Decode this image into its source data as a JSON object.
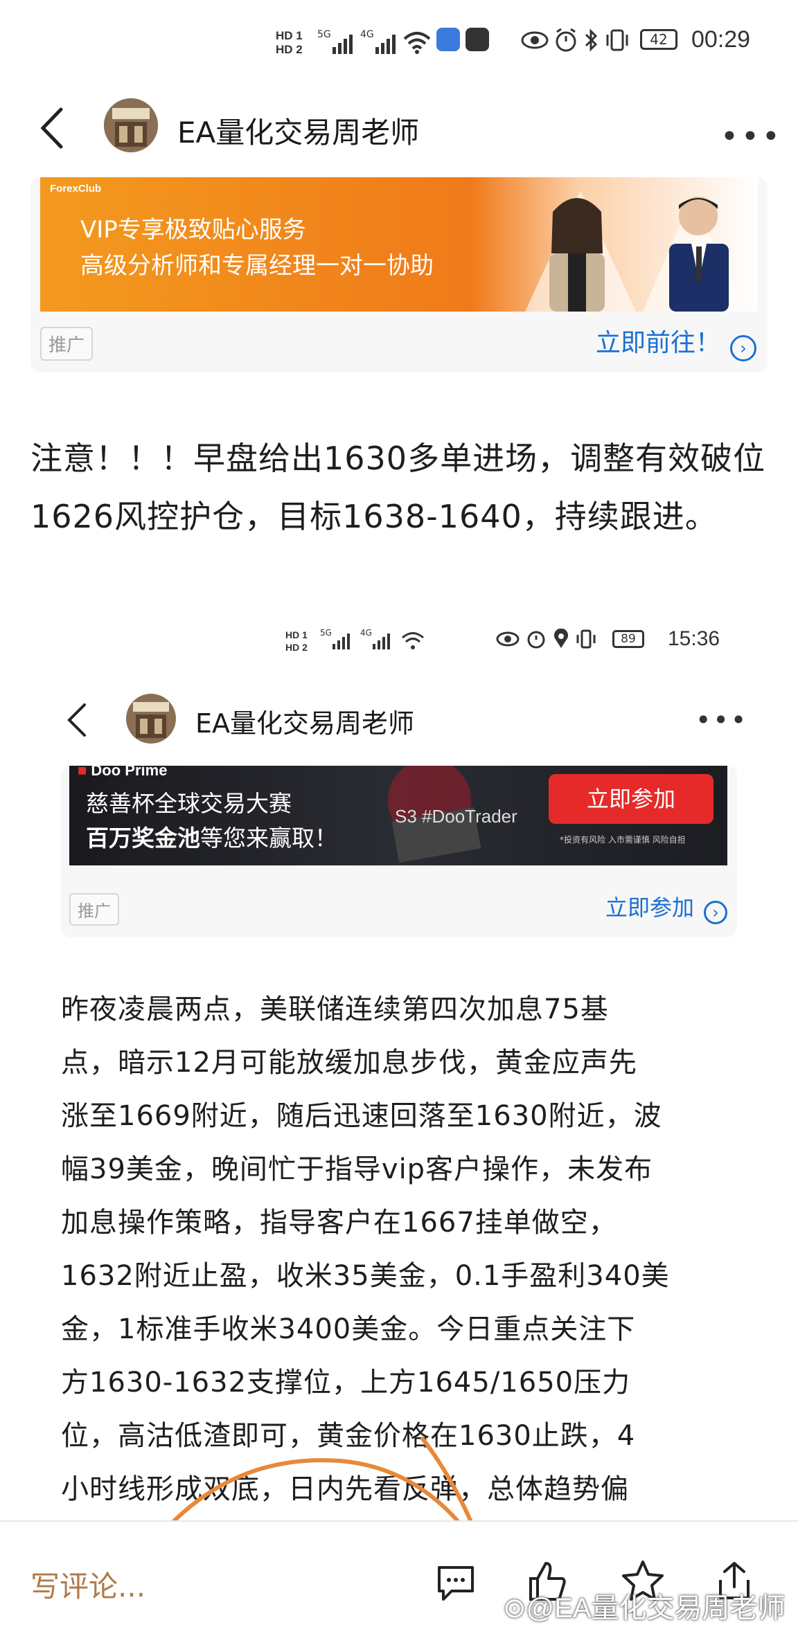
{
  "status_bar": {
    "time": "00:29",
    "battery": "42",
    "net1": "HD 1",
    "net2": "HD 2",
    "sig1": "5G",
    "sig2": "4G"
  },
  "header": {
    "title": "EA量化交易周老师"
  },
  "ad1": {
    "brand": "ForexClub",
    "line1": "VIP专享极致贴心服务",
    "line2": "高级分析师和专属经理一对一协助",
    "tag": "推广",
    "cta": "立即前往！"
  },
  "article": {
    "text": "注意！！！早盘给出1630多单进场，调整有效破位1626风控护仓，目标1638-1640，持续跟进。"
  },
  "shot": {
    "status": {
      "time": "15:36",
      "battery": "89"
    },
    "title": "EA量化交易周老师",
    "ad": {
      "brand": "Doo Prime",
      "line1": "慈善杯全球交易大赛",
      "line2a": "百万奖金池",
      "line2b": "等您来赢取！",
      "hashtag": "S3 #DooTrader",
      "button": "立即参加",
      "disclaimer": "*投资有风险 入市需谨慎 风险自担",
      "tag": "推广",
      "cta": "立即参加"
    },
    "paragraph_lines": [
      "昨夜凌晨两点，美联储连续第四次加息75基",
      "点，暗示12月可能放缓加息步伐，黄金应声先",
      "涨至1669附近，随后迅速回落至1630附近，波",
      "幅39美金，晚间忙于指导vip客户操作，未发布",
      "加息操作策略，指导客户在1667挂单做空，",
      "1632附近止盈，收米35美金，0.1手盈利340美",
      "金，1标准手收米3400美金。今日重点关注下",
      "方1630-1632支撑位，上方1645/1650压力",
      "位，高沽低渣即可，黄金价格在1630止跌，4",
      "小时线形成双底，日内先看反弹，总体趋势偏"
    ]
  },
  "bottom_bar": {
    "comment_placeholder": "写评论...",
    "watermark": "@EA量化交易周老师"
  },
  "colors": {
    "orange_ad": "#f28a1a",
    "cta_blue": "#1b6fd1",
    "doo_red": "#e62a2a",
    "comment_brown": "#b07a4a"
  }
}
